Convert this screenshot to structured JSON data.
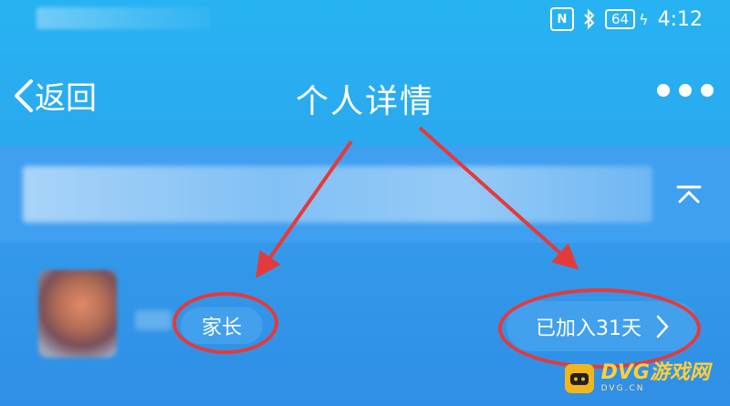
{
  "status_bar": {
    "battery": "64",
    "time": "4:12",
    "icons": [
      "nfc-icon",
      "bluetooth-icon",
      "battery-icon",
      "charging-icon"
    ]
  },
  "nav": {
    "back_label": "返回",
    "title": "个人详情",
    "icons": [
      "chevron-left-icon",
      "more-icon"
    ]
  },
  "profile": {
    "role": "家长",
    "joined": "已加入31天"
  },
  "watermark": {
    "name": "DVG游戏网",
    "url": "DVG.CN"
  },
  "colors": {
    "header_top": "#27b3f3",
    "notice_band": "#3f9ff0",
    "highlight": "#e53a3a",
    "watermark": "#ffcf3a"
  }
}
